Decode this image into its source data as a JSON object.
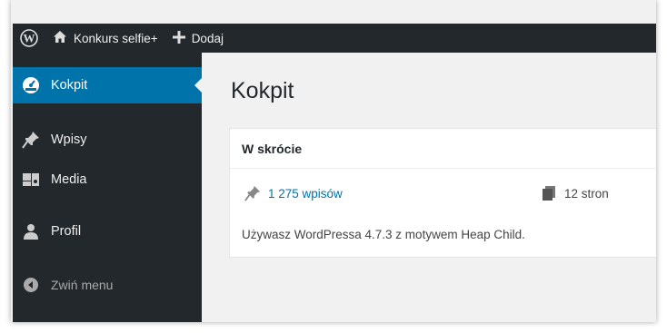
{
  "admin_bar": {
    "logo_icon": "wordpress-logo-icon",
    "site_name": "Konkurs selfie+",
    "add_label": "Dodaj"
  },
  "sidebar": {
    "items": [
      {
        "label": "Kokpit",
        "icon": "dashboard-icon",
        "current": true
      },
      {
        "label": "Wpisy",
        "icon": "pin-icon"
      },
      {
        "label": "Media",
        "icon": "media-icon"
      },
      {
        "label": "Profil",
        "icon": "user-icon"
      }
    ],
    "collapse_label": "Zwiń menu"
  },
  "main": {
    "title": "Kokpit",
    "widget": {
      "title": "W skrócie",
      "posts_label": "1 275 wpisów",
      "pages_label": "12 stron",
      "version_text": "Używasz WordPressa 4.7.3 z motywem Heap Child."
    }
  },
  "colors": {
    "admin_dark": "#23282d",
    "accent": "#0073aa",
    "background": "#f1f1f1"
  }
}
